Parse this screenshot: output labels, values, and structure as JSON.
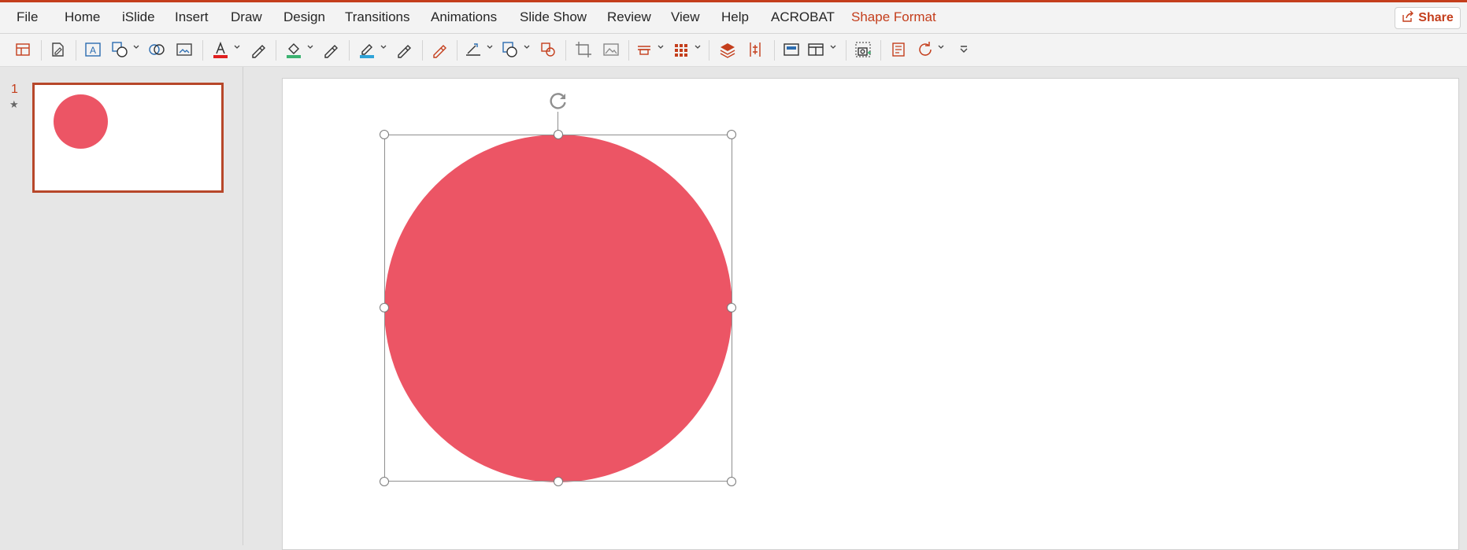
{
  "menu": {
    "items": [
      "File",
      "Home",
      "iSlide",
      "Insert",
      "Draw",
      "Design",
      "Transitions",
      "Animations",
      "Slide Show",
      "Review",
      "View",
      "Help",
      "ACROBAT",
      "Shape Format"
    ],
    "active": "Shape Format",
    "share_label": "Share"
  },
  "toolbar": {
    "icons": [
      "insert-shapes-icon",
      "edit-shape-icon",
      "text-box-icon",
      "shapes-gallery-icon",
      "merge-shapes-icon",
      "alt-text-icon",
      "font-color-icon",
      "text-eyedropper-icon",
      "shape-fill-icon",
      "fill-eyedropper-icon",
      "shape-outline-icon",
      "outline-eyedropper-icon",
      "effects-eyedropper-icon",
      "line-style-icon",
      "shape-style-icon",
      "shape-effects-icon",
      "crop-icon",
      "picture-icon",
      "align-icon",
      "group-icon",
      "layers-icon",
      "distribute-icon",
      "selection-pane-icon",
      "arrange-icon",
      "screenshot-icon",
      "format-pane-icon",
      "rotate-icon",
      "more-options-icon"
    ]
  },
  "slides": {
    "number": "1",
    "animation_marker": "★"
  },
  "colors": {
    "accent": "#c43e1c",
    "shape_fill": "#ec5565",
    "thumb_border": "#b7472a"
  }
}
